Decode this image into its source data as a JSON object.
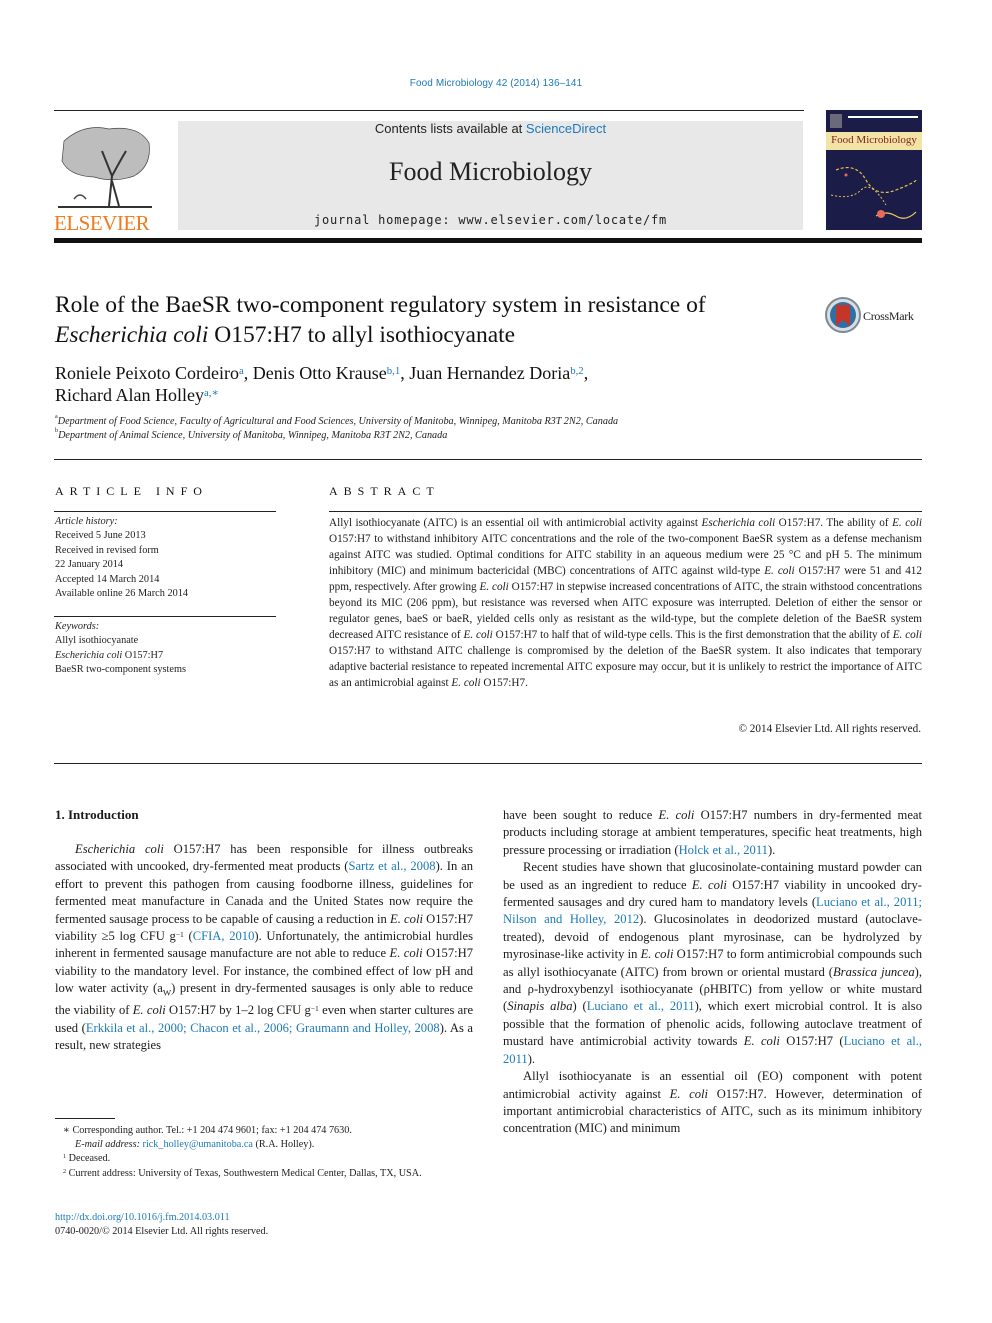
{
  "header": {
    "citation": "Food Microbiology 42 (2014) 136–141",
    "contents_prefix": "Contents lists available at ",
    "contents_link": "ScienceDirect",
    "journal_title": "Food Microbiology",
    "homepage": "journal homepage: www.elsevier.com/locate/fm",
    "publisher_logo_text": "ELSEVIER",
    "cover_title": "Food Microbiology",
    "crossmark_label": "CrossMark"
  },
  "colors": {
    "link": "#1c7ab8",
    "elsevier_orange": "#f07a1c",
    "banner_gray": "#e8e8e8"
  },
  "article": {
    "title_line1": "Role of the BaeSR two-component regulatory system in resistance of",
    "title_line2_italic": "Escherichia coli",
    "title_line2_rest": " O157:H7 to allyl isothiocyanate",
    "authors": [
      {
        "name": "Roniele Peixoto Cordeiro",
        "sup": "a",
        "sep": ", "
      },
      {
        "name": "Denis Otto Krause",
        "sup": "b,1",
        "sep": ", "
      },
      {
        "name": "Juan Hernandez Doria",
        "sup": "b,2",
        "sep": ","
      },
      {
        "name": "Richard Alan Holley",
        "sup": "a,∗",
        "sep": ""
      }
    ],
    "affiliations": [
      {
        "sup": "a",
        "text": "Department of Food Science, Faculty of Agricultural and Food Sciences, University of Manitoba, Winnipeg, Manitoba R3T 2N2, Canada"
      },
      {
        "sup": "b",
        "text": "Department of Animal Science, University of Manitoba, Winnipeg, Manitoba R3T 2N2, Canada"
      }
    ]
  },
  "article_info": {
    "heading": "ARTICLE INFO",
    "history_label": "Article history:",
    "history": [
      "Received 5 June 2013",
      "Received in revised form",
      "22 January 2014",
      "Accepted 14 March 2014",
      "Available online 26 March 2014"
    ],
    "keywords_label": "Keywords:",
    "keywords": [
      {
        "italic": "",
        "text": "Allyl isothiocyanate"
      },
      {
        "italic": "Escherichia coli",
        "text": " O157:H7"
      },
      {
        "italic": "",
        "text": "BaeSR two-component systems"
      }
    ]
  },
  "abstract": {
    "heading": "ABSTRACT",
    "segments": [
      {
        "t": "Allyl isothiocyanate (AITC) is an essential oil with antimicrobial activity against "
      },
      {
        "i": "Escherichia coli"
      },
      {
        "t": " O157:H7. The ability of "
      },
      {
        "i": "E. coli"
      },
      {
        "t": " O157:H7 to withstand inhibitory AITC concentrations and the role of the two-component BaeSR system as a defense mechanism against AITC was studied. Optimal conditions for AITC stability in an aqueous medium were 25 °C and pH 5. The minimum inhibitory (MIC) and minimum bactericidal (MBC) concentrations of AITC against wild-type "
      },
      {
        "i": "E. coli"
      },
      {
        "t": " O157:H7 were 51 and 412 ppm, respectively. After growing "
      },
      {
        "i": "E. coli"
      },
      {
        "t": " O157:H7 in stepwise increased concentrations of AITC, the strain withstood concentrations beyond its MIC (206 ppm), but resistance was reversed when AITC exposure was interrupted. Deletion of either the sensor or regulator genes, baeS or baeR, yielded cells only as resistant as the wild-type, but the complete deletion of the BaeSR system decreased AITC resistance of "
      },
      {
        "i": "E. coli"
      },
      {
        "t": " O157:H7 to half that of wild-type cells. This is the first demonstration that the ability of "
      },
      {
        "i": "E. coli"
      },
      {
        "t": " O157:H7 to withstand AITC challenge is compromised by the deletion of the BaeSR system. It also in­dicates that temporary adaptive bacterial resistance to repeated incremental AITC exposure may occur, but it is unlikely to restrict the importance of AITC as an antimicrobial against "
      },
      {
        "i": "E. coli"
      },
      {
        "t": " O157:H7."
      }
    ],
    "copyright": "© 2014 Elsevier Ltd. All rights reserved."
  },
  "introduction": {
    "heading": "1.  Introduction",
    "left_paragraphs": [
      [
        {
          "i": "Escherichia coli"
        },
        {
          "t": " O157:H7 has been responsible for illness out­breaks associated with uncooked, dry-fermented meat products ("
        },
        {
          "l": "Sartz et al., 2008"
        },
        {
          "t": "). In an effort to prevent this pathogen from causing foodborne illness, guidelines for fermented meat manu­facture in Canada and the United States now require the fermented sausage process to be capable of causing a reduction in "
        },
        {
          "i": "E. coli"
        },
        {
          "t": " O157:H7 viability ≥5 log CFU g"
        },
        {
          "s": "−1"
        },
        {
          "t": " ("
        },
        {
          "l": "CFIA, 2010"
        },
        {
          "t": "). Unfortunately, the antimicrobial hurdles inherent in fermented sausage manufacture are not able to reduce "
        },
        {
          "i": "E. coli"
        },
        {
          "t": " O157:H7 viability to the mandatory level. For instance, the combined effect of low pH and low water activity (a"
        },
        {
          "sub": "W"
        },
        {
          "t": ") present in dry-fermented sausages is only able to reduce the viability of "
        },
        {
          "i": "E. coli"
        },
        {
          "t": " O157:H7 by 1–2 log CFU g"
        },
        {
          "s": "−1"
        },
        {
          "t": " even when starter cultures are used ("
        },
        {
          "l": "Erkkila et al., 2000; Chacon et al., 2006; Graumann and Holley, 2008"
        },
        {
          "t": "). As a result, new strategies"
        }
      ]
    ],
    "right_paragraphs": [
      [
        {
          "t": "have been sought to reduce "
        },
        {
          "i": "E. coli"
        },
        {
          "t": " O157:H7 numbers in dry-fermented meat products including storage at ambient tempera­tures, specific heat treatments, high pressure processing or irradi­ation ("
        },
        {
          "l": "Holck et al., 2011"
        },
        {
          "t": ")."
        }
      ],
      [
        {
          "t": "Recent studies have shown that glucosinolate-containing mustard powder can be used as an ingredient to reduce "
        },
        {
          "i": "E. coli"
        },
        {
          "t": " O157:H7 viability in uncooked dry-fermented sausages and dry cured ham to mandatory levels ("
        },
        {
          "l": "Luciano et al., 2011; Nilson and Holley, 2012"
        },
        {
          "t": "). Glucosinolates in deodorized mustard (autoclave-treated), devoid of endogenous plant myrosinase, can be hydro­lyzed by myrosinase-like activity in "
        },
        {
          "i": "E. coli"
        },
        {
          "t": " O157:H7 to form anti­microbial compounds such as allyl isothiocyanate (AITC) from brown or oriental mustard ("
        },
        {
          "i": "Brassica juncea"
        },
        {
          "t": "), and ρ-hydroxybenzyl isothiocyanate (ρHBITC) from yellow or white mustard ("
        },
        {
          "i": "Sinapis alba"
        },
        {
          "t": ") ("
        },
        {
          "l": "Luciano et al., 2011"
        },
        {
          "t": "), which exert microbial control. It is also possible that the formation of phenolic acids, following autoclave treatment of mustard have antimicrobial activity towards "
        },
        {
          "i": "E. coli"
        },
        {
          "t": " O157:H7 ("
        },
        {
          "l": "Luciano et al., 2011"
        },
        {
          "t": ")."
        }
      ],
      [
        {
          "t": "Allyl isothiocyanate is an essential oil (EO) component with potent antimicrobial activity against "
        },
        {
          "i": "E. coli"
        },
        {
          "t": " O157:H7. However, determination of important antimicrobial characteristics of AITC, such as its minimum inhibitory concentration (MIC) and minimum"
        }
      ]
    ]
  },
  "footnotes": {
    "corresponding": "∗  Corresponding author. Tel.: +1 204 474 9601; fax: +1 204 474 7630.",
    "email_label": "E-mail address: ",
    "email": "rick_holley@umanitoba.ca",
    "email_suffix": " (R.A. Holley).",
    "note1_sup": "1",
    "note1": "  Deceased.",
    "note2_sup": "2",
    "note2": "  Current address: University of Texas, Southwestern Medical Center, Dallas, TX, USA."
  },
  "doi": {
    "link": "http://dx.doi.org/10.1016/j.fm.2014.03.011",
    "issn_line": "0740-0020/© 2014 Elsevier Ltd. All rights reserved."
  }
}
